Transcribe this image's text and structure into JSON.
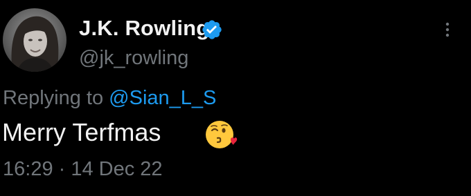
{
  "tweet": {
    "display_name": "J.K. Rowling",
    "handle": "@jk_rowling",
    "reply_prefix": "Replying to",
    "reply_mention": "@Sian_L_S",
    "text": "Merry Terfmas",
    "emoji": "face-blowing-a-kiss-icon",
    "timestamp": "16:29 · 14 Dec 22",
    "verified_icon": "verified-badge-icon",
    "more_icon": "more-options-icon"
  },
  "colors": {
    "background": "#000000",
    "primary_text": "#e7e9ea",
    "secondary_text": "#71767b",
    "accent": "#1d9bf0"
  }
}
